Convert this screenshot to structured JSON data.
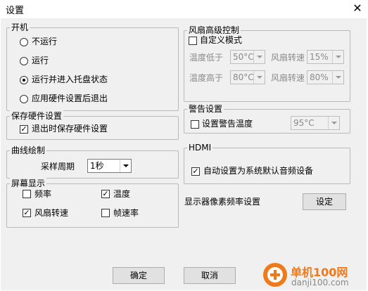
{
  "window": {
    "title": "设置",
    "close_glyph": "✕"
  },
  "startup": {
    "legend": "开机",
    "options": [
      {
        "label": "不运行",
        "checked": false
      },
      {
        "label": "运行",
        "checked": false
      },
      {
        "label": "运行并进入托盘状态",
        "checked": true
      },
      {
        "label": "应用硬件设置后退出",
        "checked": false
      }
    ]
  },
  "save_hw": {
    "legend": "保存硬件设置",
    "save_on_exit": "退出时保存硬件设置",
    "checked": true
  },
  "curve": {
    "legend": "曲线绘制",
    "period_label": "采样周期",
    "period_value": "1秒"
  },
  "display": {
    "legend": "屏幕显示",
    "frequency": "频率",
    "frequency_checked": false,
    "temperature": "温度",
    "temperature_checked": true,
    "fan_speed": "风扇转速",
    "fan_speed_checked": true,
    "frame_rate": "帧速率",
    "frame_rate_checked": false
  },
  "fan": {
    "legend": "风扇高级控制",
    "custom_mode": "自定义模式",
    "custom_checked": false,
    "temp_low_label": "温度低于",
    "temp_low_value": "50°C",
    "speed_label_1": "风扇转速",
    "speed_value_1": "15%",
    "temp_high_label": "温度高于",
    "temp_high_value": "80°C",
    "speed_label_2": "风扇转速",
    "speed_value_2": "80%"
  },
  "alarm": {
    "legend": "警告设置",
    "set_temp": "设置警告温度",
    "checked": false,
    "temp_value": "95°C"
  },
  "hdmi": {
    "legend": "HDMI",
    "auto_audio": "自动设置为系统默认音频设备",
    "checked": true
  },
  "refresh": {
    "label": "显示器像素频率设置",
    "button": "设定"
  },
  "footer": {
    "ok": "确定",
    "cancel": "取消"
  },
  "watermark": {
    "site_cn": "单机100网",
    "site_url": "danji100.com"
  },
  "colors": {
    "logo_orange": "#f07a1a",
    "logo_grey": "#888888"
  }
}
